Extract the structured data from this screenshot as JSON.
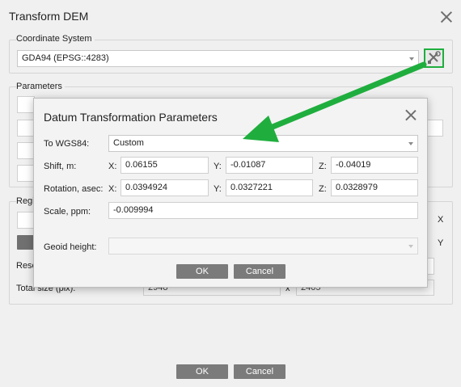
{
  "main": {
    "title": "Transform DEM",
    "coordinate_system": {
      "group_label": "Coordinate System",
      "value": "GDA94 (EPSG::4283)"
    },
    "parameters_label": "Parameters",
    "region_label": "Regi",
    "x_label": "X",
    "y_label": "Y",
    "resolution_label": "Reso",
    "total_size_label": "Total size (pix):",
    "total_size_x": "2948",
    "total_size_sep": "x",
    "total_size_y": "2405",
    "ok_label": "OK",
    "cancel_label": "Cancel"
  },
  "dialog": {
    "title": "Datum Transformation Parameters",
    "to_wgs84_label": "To WGS84:",
    "to_wgs84_value": "Custom",
    "shift_label": "Shift, m:",
    "shift": {
      "x_label": "X:",
      "x": "0.06155",
      "y_label": "Y:",
      "y": "-0.01087",
      "z_label": "Z:",
      "z": "-0.04019"
    },
    "rotation_label": "Rotation, asec:",
    "rotation": {
      "x_label": "X:",
      "x": "0.0394924",
      "y_label": "Y:",
      "y": "0.0327221",
      "z_label": "Z:",
      "z": "0.0328979"
    },
    "scale_label": "Scale, ppm:",
    "scale_value": "-0.009994",
    "geoid_label": "Geoid height:",
    "geoid_value": "",
    "ok_label": "OK",
    "cancel_label": "Cancel"
  },
  "colors": {
    "highlight_green": "#1fae3e",
    "button_gray": "#7b7b7b"
  },
  "icons": {
    "settings_tool": "tools-icon",
    "close": "close-icon",
    "dropdown": "chevron-down-icon"
  }
}
